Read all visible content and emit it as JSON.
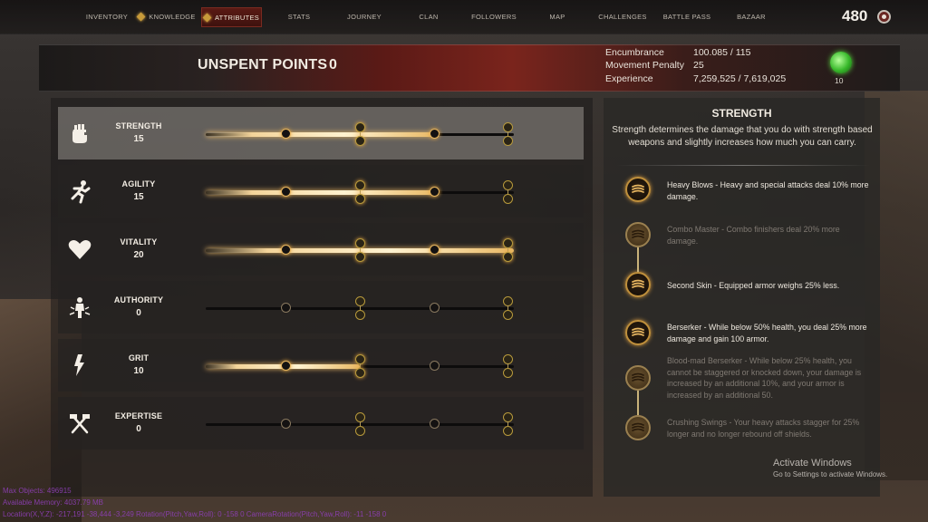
{
  "nav": {
    "tabs": [
      {
        "label": "INVENTORY"
      },
      {
        "label": "KNOWLEDGE"
      },
      {
        "label": "ATTRIBUTES"
      },
      {
        "label": "STATS"
      },
      {
        "label": "JOURNEY"
      },
      {
        "label": "CLAN"
      },
      {
        "label": "FOLLOWERS"
      },
      {
        "label": "MAP"
      },
      {
        "label": "CHALLENGES"
      },
      {
        "label": "BATTLE PASS"
      },
      {
        "label": "BAZAAR"
      }
    ],
    "active_tab": "ATTRIBUTES",
    "currency": "480"
  },
  "header": {
    "unspent_label": "UNSPENT POINTS",
    "unspent_value": "0",
    "stats": [
      {
        "label": "Encumbrance",
        "value": "100.085 / 115"
      },
      {
        "label": "Movement Penalty",
        "value": "25"
      },
      {
        "label": "Experience",
        "value": "7,259,525 / 7,619,025"
      }
    ],
    "potion_count": "10"
  },
  "attributes": [
    {
      "name": "STRENGTH",
      "value": "15",
      "icon": "fist-icon",
      "progress": 0.75,
      "selected": true
    },
    {
      "name": "AGILITY",
      "value": "15",
      "icon": "runner-icon",
      "progress": 0.75,
      "selected": false
    },
    {
      "name": "VITALITY",
      "value": "20",
      "icon": "heart-icon",
      "progress": 1.0,
      "selected": false
    },
    {
      "name": "AUTHORITY",
      "value": "0",
      "icon": "authority-icon",
      "progress": 0.0,
      "selected": false
    },
    {
      "name": "GRIT",
      "value": "10",
      "icon": "lightning-icon",
      "progress": 0.5,
      "selected": false
    },
    {
      "name": "EXPERTISE",
      "value": "0",
      "icon": "crossed-hammers-icon",
      "progress": 0.0,
      "selected": false
    }
  ],
  "detail": {
    "title": "STRENGTH",
    "description": "Strength determines the damage that you do with strength based weapons and slightly increases how much you can carry.",
    "perks": [
      {
        "text": "Heavy Blows - Heavy and special attacks deal 10% more damage.",
        "unlocked": true
      },
      {
        "text": "Combo Master - Combo finishers deal 20% more damage.",
        "unlocked": false
      },
      {
        "text": "Second Skin - Equipped armor weighs 25% less.",
        "unlocked": true
      },
      {
        "text": "Berserker - While below 50% health, you deal 25% more damage and gain 100 armor.",
        "unlocked": true
      },
      {
        "text": "Blood-mad Berserker - While below 25% health, you cannot be staggered or knocked down, your damage is increased by an additional 10%, and your armor is increased by an additional 50.",
        "unlocked": false
      },
      {
        "text": "Crushing Swings - Your heavy attacks stagger for 25% longer and no longer rebound off shields.",
        "unlocked": false
      }
    ]
  },
  "watermark": {
    "title": "Activate Windows",
    "subtitle": "Go to Settings to activate Windows."
  },
  "debug": {
    "line1": "Max Objects: 496915",
    "line2": "Available Memory: 4037.79 MB",
    "line3": "Location(X,Y,Z): -217,191  -38,444  -3,249    Rotation(Pitch,Yaw,Roll): 0  -158  0    CameraRotation(Pitch,Yaw,Roll): -11  -158  0"
  },
  "colors": {
    "accent_gold": "#e6b560",
    "active_tab_red": "#5a1a14",
    "banner_red": "#7a241c"
  }
}
